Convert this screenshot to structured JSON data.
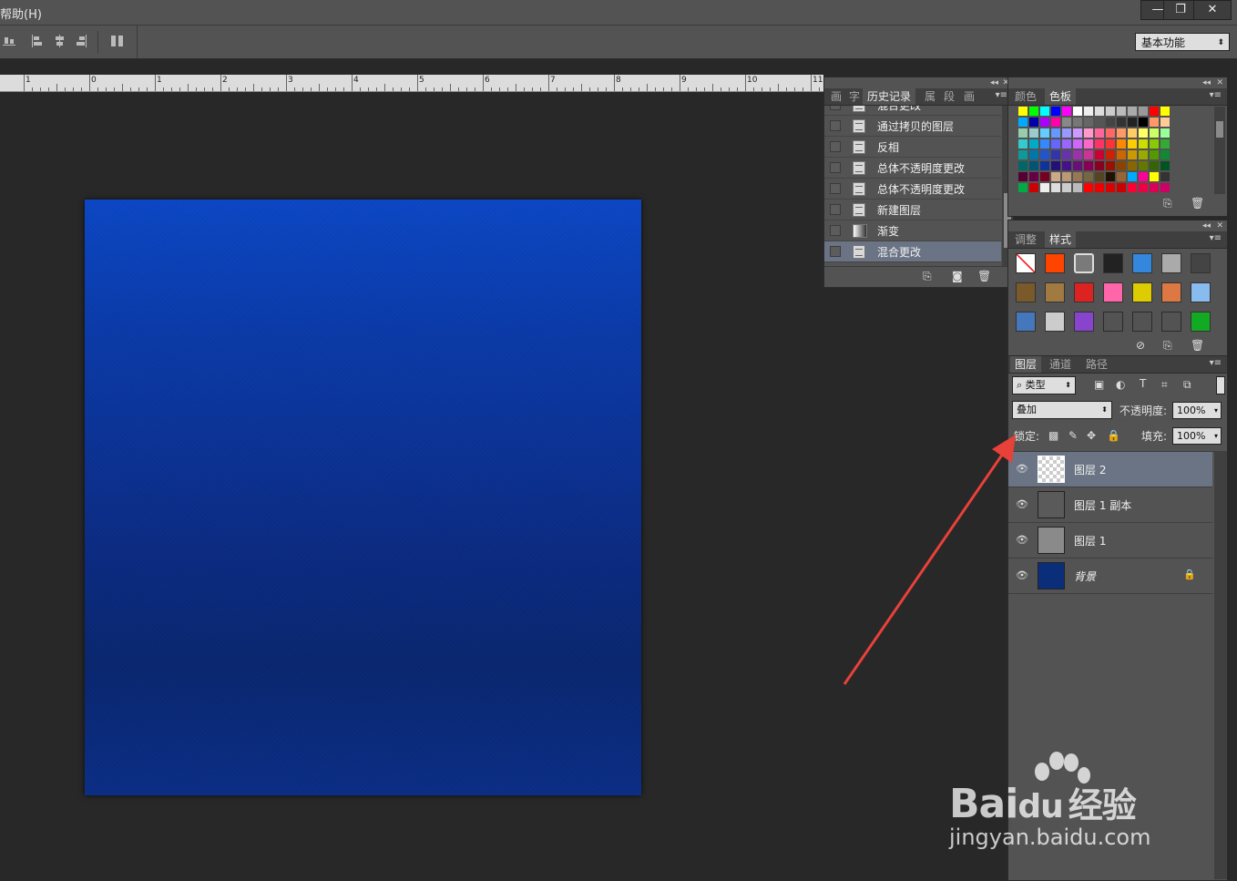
{
  "menubar": {
    "partial_menu": "帮助(H)",
    "window_buttons": [
      "—",
      "❐",
      "✕"
    ]
  },
  "options_bar": {
    "workspace": "基本功能"
  },
  "ruler": {
    "labels": [
      "1",
      "0",
      "1",
      "2",
      "3",
      "4",
      "5",
      "6",
      "7",
      "8",
      "9",
      "10",
      "11"
    ]
  },
  "history_panel": {
    "tabs": [
      "画",
      "字",
      "历史记录",
      "属",
      "段",
      "画"
    ],
    "active_tab": "历史记录",
    "items": [
      {
        "label": "混合更改",
        "kind": "doc",
        "selected": false
      },
      {
        "label": "通过拷贝的图层",
        "kind": "doc",
        "selected": false
      },
      {
        "label": "反相",
        "kind": "doc",
        "selected": false
      },
      {
        "label": "总体不透明度更改",
        "kind": "doc",
        "selected": false
      },
      {
        "label": "总体不透明度更改",
        "kind": "doc",
        "selected": false
      },
      {
        "label": "新建图层",
        "kind": "doc",
        "selected": false
      },
      {
        "label": "渐变",
        "kind": "gradient",
        "selected": false
      },
      {
        "label": "混合更改",
        "kind": "doc",
        "selected": true
      }
    ]
  },
  "swatches_panel": {
    "tabs": [
      "颜色",
      "色板"
    ],
    "active_tab": "色板",
    "rows": [
      [
        "#ffff00",
        "#00ff00",
        "#00ffff",
        "#0000ff",
        "#ff00ff",
        "#ffffff",
        "#eeeeee",
        "#dddddd",
        "#cccccc",
        "#bbbbbb",
        "#aaaaaa",
        "#999999",
        "#ff0000",
        "#ffff00"
      ],
      [
        "#00aaff",
        "#0000aa",
        "#aa00ff",
        "#ff00aa",
        "#888888",
        "#777777",
        "#666666",
        "#555555",
        "#444444",
        "#333333",
        "#222222",
        "#000000",
        "#ff9966",
        "#ffcc99"
      ],
      [
        "#99ccaa",
        "#99cccc",
        "#66ccff",
        "#6699ff",
        "#9999ff",
        "#cc99ff",
        "#ff99cc",
        "#ff6699",
        "#ff6666",
        "#ff9966",
        "#ffcc66",
        "#ffff66",
        "#ccff66",
        "#99ff99"
      ],
      [
        "#33cccc",
        "#00aacc",
        "#3388ff",
        "#6666ff",
        "#9966ff",
        "#cc66ff",
        "#ff66cc",
        "#ff3366",
        "#ff3333",
        "#ff8800",
        "#ffcc00",
        "#ccdd00",
        "#88cc00",
        "#33aa33"
      ],
      [
        "#119999",
        "#0077aa",
        "#2255cc",
        "#3333aa",
        "#6633aa",
        "#9933aa",
        "#cc3399",
        "#cc0033",
        "#cc2200",
        "#cc6600",
        "#cc9900",
        "#99aa00",
        "#559900",
        "#118833"
      ],
      [
        "#006666",
        "#005577",
        "#113399",
        "#221177",
        "#441188",
        "#661177",
        "#880055",
        "#880022",
        "#991100",
        "#884400",
        "#886600",
        "#667700",
        "#336600",
        "#005522"
      ],
      [
        "#550033",
        "#660044",
        "#770022",
        "#ccaa88",
        "#bb9977",
        "#997755",
        "#776644",
        "#554422",
        "#221100",
        "#996633",
        "#00aaff",
        "#ff0099",
        "#ffff00",
        "#333333"
      ],
      [
        "#00aa44",
        "#cc0000",
        "#eeeeee",
        "#dddddd",
        "#cccccc",
        "#bbbbbb",
        "#ff0000",
        "#ee0000",
        "#dd0000",
        "#cc0000",
        "#ff0033",
        "#ee0044",
        "#dd0055",
        "#cc0066"
      ]
    ]
  },
  "styles_panel": {
    "tabs": [
      "调整",
      "样式"
    ],
    "active_tab": "样式",
    "items": [
      {
        "name": "none-style",
        "color": "#ffffff"
      },
      {
        "name": "fire-style",
        "color": "#ff4400"
      },
      {
        "name": "outline-style",
        "color": "#7a7a7a"
      },
      {
        "name": "dark-ring-style",
        "color": "#222222"
      },
      {
        "name": "blue-sky-style",
        "color": "#3388dd"
      },
      {
        "name": "gray-style",
        "color": "#aaaaaa"
      },
      {
        "name": "dark-gray-style",
        "color": "#444444"
      },
      {
        "name": "wood-style",
        "color": "#7a5a2a"
      },
      {
        "name": "bronze-style",
        "color": "#a07a40"
      },
      {
        "name": "red-glass-style",
        "color": "#dd2222"
      },
      {
        "name": "rainbow-style",
        "color": "#ff66aa"
      },
      {
        "name": "yellow-style",
        "color": "#ddcc00"
      },
      {
        "name": "sunset-style",
        "color": "#dd7744"
      },
      {
        "name": "light-blue-style",
        "color": "#88bbee"
      },
      {
        "name": "landscape-style",
        "color": "#4477bb"
      },
      {
        "name": "chrome-style",
        "color": "#cccccc"
      },
      {
        "name": "purple-style",
        "color": "#8844cc"
      },
      {
        "name": "empty-style-1",
        "color": "#535353"
      },
      {
        "name": "empty-style-2",
        "color": "#535353"
      },
      {
        "name": "empty-style-3",
        "color": "#535353"
      },
      {
        "name": "green-style",
        "color": "#11aa22"
      }
    ]
  },
  "layers_panel": {
    "tabs": [
      "图层",
      "通道",
      "路径"
    ],
    "active_tab": "图层",
    "filter_type": "类型",
    "blend_mode": "叠加",
    "opacity_label": "不透明度:",
    "opacity_value": "100%",
    "lock_label": "锁定:",
    "fill_label": "填充:",
    "fill_value": "100%",
    "layers": [
      {
        "name": "图层 2",
        "thumb": "transparent",
        "selected": true,
        "locked": false
      },
      {
        "name": "图层 1 副本",
        "thumb": "#5a5a5a",
        "selected": false,
        "locked": false
      },
      {
        "name": "图层 1",
        "thumb": "#8a8a8a",
        "selected": false,
        "locked": false
      },
      {
        "name": "背景",
        "thumb": "#0b2e7a",
        "selected": false,
        "locked": true
      }
    ]
  },
  "watermark": {
    "brand": "Bai",
    "brand2": "du",
    "brand_cn": "经验",
    "url": "jingyan.baidu.com"
  }
}
